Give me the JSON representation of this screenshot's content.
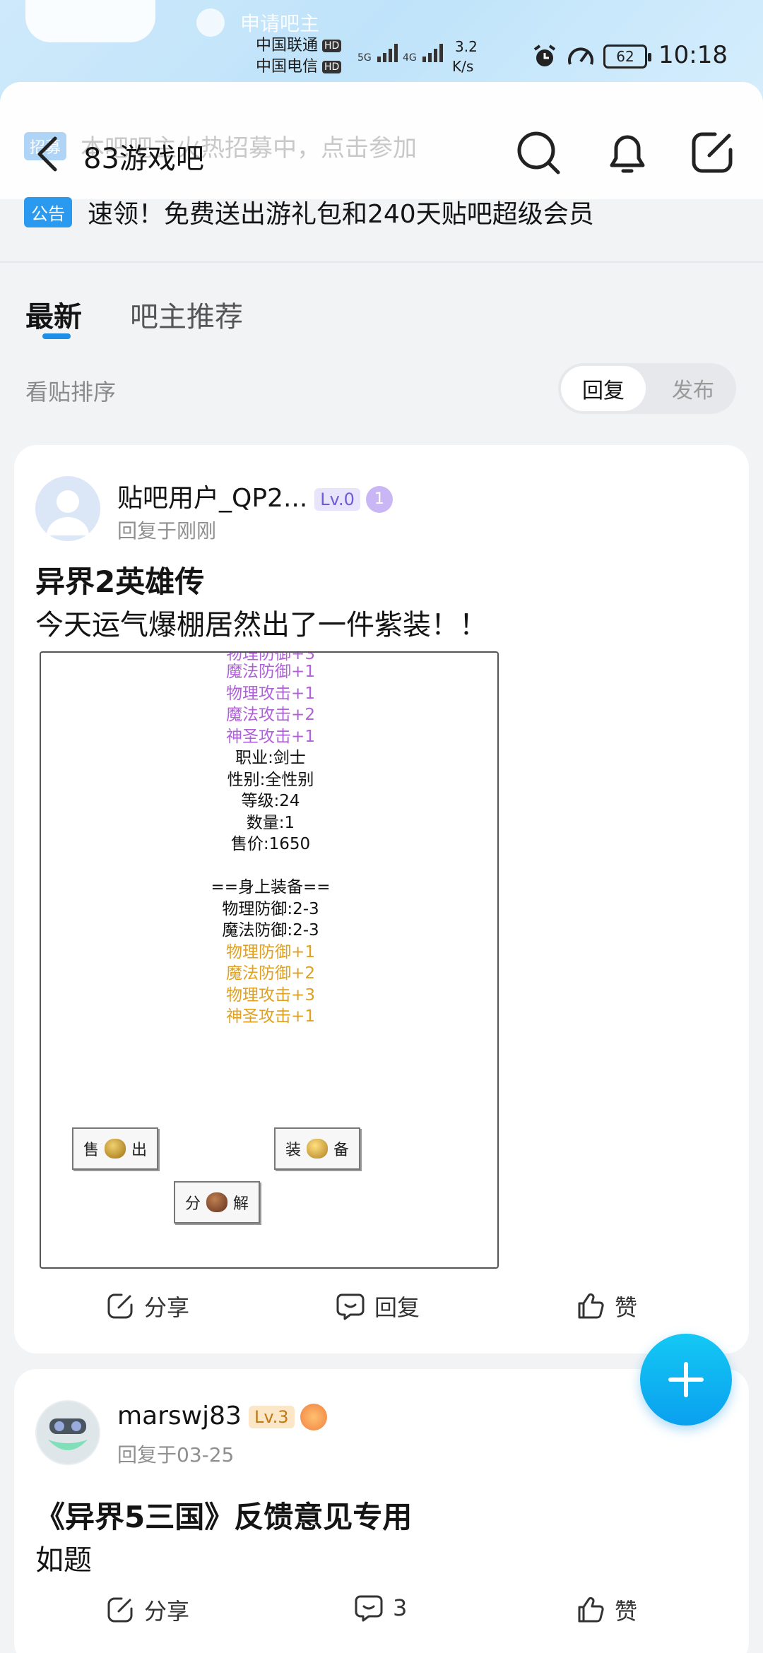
{
  "status_bar": {
    "carrier1": "中国联通",
    "carrier2": "中国电信",
    "hd": "HD",
    "net1": "5G",
    "net2": "4G",
    "speed_value": "3.2",
    "speed_unit": "K/s",
    "battery": "62",
    "time": "10:18"
  },
  "background": {
    "apply_text": "申请吧主"
  },
  "header": {
    "title": "83游戏吧",
    "ghost_tag": "招募",
    "ghost_text": "本吧吧主火热招募中，点击参加"
  },
  "notice": {
    "tag": "公告",
    "text": "速领！免费送出游礼包和240天贴吧超级会员"
  },
  "tabs": [
    {
      "label": "最新"
    },
    {
      "label": "吧主推荐"
    }
  ],
  "sort": {
    "label": "看贴排序",
    "options": [
      "回复",
      "发布"
    ],
    "selected": "回复"
  },
  "posts": [
    {
      "username": "贴吧用户_QP2...",
      "level": "Lv.0",
      "medal": "1",
      "meta": "回复于刚刚",
      "title": "异界2英雄传",
      "body": "今天运气爆棚居然出了一件紫装！！",
      "image": {
        "lines_purple": [
          "魔法防御+1",
          "物理攻击+1",
          "魔法攻击+2",
          "神圣攻击+1"
        ],
        "lines_black": [
          "职业:剑士",
          "性别:全性别",
          "等级:24",
          "数量:1",
          "售价:1650",
          "",
          "==身上装备==",
          "物理防御:2-3",
          "魔法防御:2-3"
        ],
        "lines_orange": [
          "物理防御+1",
          "魔法防御+2",
          "物理攻击+3",
          "神圣攻击+1"
        ],
        "btn_sell": [
          "售",
          "出"
        ],
        "btn_equip": [
          "装",
          "备"
        ],
        "btn_decompose": [
          "分",
          "解"
        ]
      },
      "actions": {
        "share": "分享",
        "reply": "回复",
        "like": "赞"
      }
    },
    {
      "username": "marswj83",
      "level": "Lv.3",
      "meta": "回复于03-25",
      "title": "《异界5三国》反馈意见专用",
      "body": "如题",
      "actions": {
        "share": "分享",
        "reply": "3",
        "like": "赞"
      }
    }
  ],
  "colors": {
    "accent": "#1d8fe8",
    "notice_tag": "#2a9af0",
    "fab": "#0aa0ef",
    "purple_text": "#b060d8",
    "orange_text": "#e0a020"
  }
}
